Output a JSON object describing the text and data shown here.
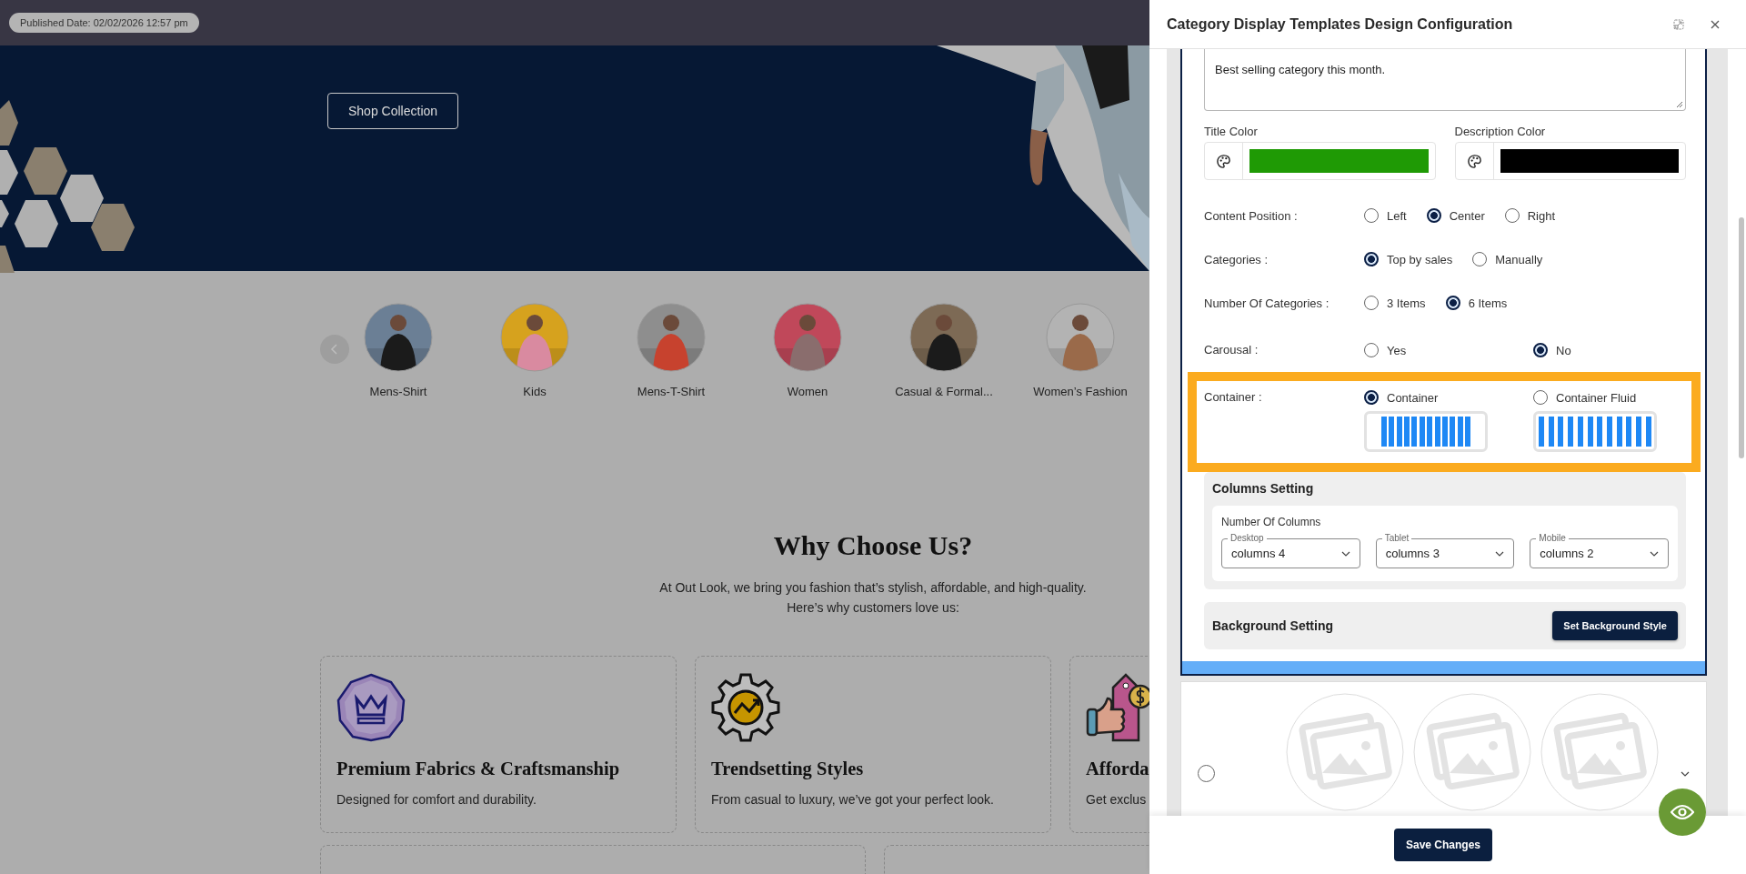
{
  "published_badge": "Published Date: 02/02/2026 12:57 pm",
  "hero": {
    "button": "Shop Collection"
  },
  "categories": {
    "items": [
      {
        "label": "Mens-Shirt"
      },
      {
        "label": "Kids"
      },
      {
        "label": "Mens-T-Shirt"
      },
      {
        "label": "Women"
      },
      {
        "label": "Casual & Formal..."
      },
      {
        "label": "Women’s Fashion"
      }
    ]
  },
  "why_choose_us": {
    "title": "Why Choose Us?",
    "intro_lines": [
      "At Out Look, we bring you fashion that’s stylish, affordable, and high-quality.",
      "Here’s why customers love us:"
    ],
    "features": [
      {
        "kind": "crown",
        "title": "Premium Fabrics & Craftsmanship",
        "description": "Designed for comfort and durability."
      },
      {
        "kind": "gear",
        "title": "Trendsetting Styles",
        "description": "From casual to luxury, we’ve got your perfect look."
      },
      {
        "kind": "tag",
        "title": "Afforda",
        "description": "Get exclus"
      }
    ]
  },
  "panel": {
    "title": "Category Display Templates Design Configuration",
    "description_value": "Best selling category this month.",
    "color_fields": [
      {
        "label": "Title Color",
        "color": "#1f9a05"
      },
      {
        "label": "Description Color",
        "color": "#000000"
      }
    ],
    "options": [
      {
        "kind": "inline",
        "label": "Content Position :",
        "highlighted": false,
        "choices": [
          {
            "label": "Left",
            "selected": false
          },
          {
            "label": "Center",
            "selected": true
          },
          {
            "label": "Right",
            "selected": false
          }
        ]
      },
      {
        "kind": "inline",
        "label": "Categories :",
        "highlighted": false,
        "choices": [
          {
            "label": "Top by sales",
            "selected": true
          },
          {
            "label": "Manually",
            "selected": false
          }
        ]
      },
      {
        "kind": "inline",
        "label": "Number Of Categories :",
        "highlighted": false,
        "choices": [
          {
            "label": "3 Items",
            "selected": false
          },
          {
            "label": "6 Items",
            "selected": true
          }
        ]
      },
      {
        "kind": "columns",
        "label": "Carousal :",
        "highlighted": false,
        "choices": [
          {
            "label": "Yes",
            "selected": false
          },
          {
            "label": "No",
            "selected": true
          }
        ]
      },
      {
        "kind": "preview",
        "label": "Container :",
        "highlighted": true,
        "choices": [
          {
            "label": "Container",
            "selected": true,
            "fluid": false
          },
          {
            "label": "Container Fluid",
            "selected": false,
            "fluid": true
          }
        ]
      }
    ],
    "columns_setting": {
      "title": "Columns Setting",
      "subtitle": "Number Of Columns",
      "selects": [
        {
          "label": "Desktop",
          "value": "columns 4"
        },
        {
          "label": "Tablet",
          "value": "columns 3"
        },
        {
          "label": "Mobile",
          "value": "columns 2"
        }
      ]
    },
    "background_setting": {
      "title": "Background Setting",
      "button": "Set Background Style"
    },
    "next_template": {
      "selected": false
    },
    "save_button": "Save Changes"
  }
}
